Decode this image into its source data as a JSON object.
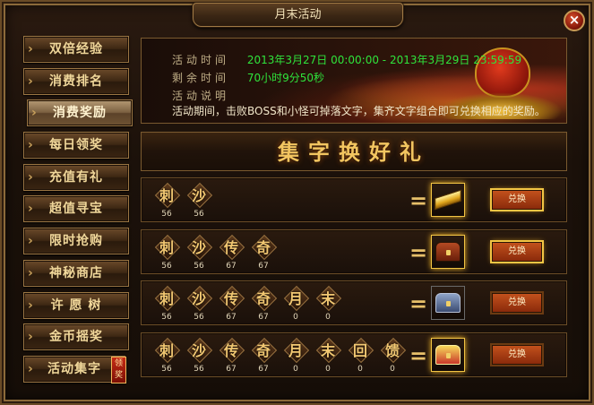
{
  "window": {
    "title": "月末活动",
    "close_label": "×"
  },
  "menu": {
    "items": [
      {
        "label": "双倍经验",
        "active": false
      },
      {
        "label": "消费排名",
        "active": false
      },
      {
        "label": "消费奖励",
        "active": true
      },
      {
        "label": "每日领奖",
        "active": false
      },
      {
        "label": "充值有礼",
        "active": false
      },
      {
        "label": "超值寻宝",
        "active": false
      },
      {
        "label": "限时抢购",
        "active": false
      },
      {
        "label": "神秘商店",
        "active": false
      },
      {
        "label": "许 愿 树",
        "active": false
      },
      {
        "label": "金币摇奖",
        "active": false
      },
      {
        "label": "活动集字",
        "active": false
      }
    ],
    "badge": "领奖"
  },
  "banner": {
    "time_label": "活动时间",
    "time_value": "2013年3月27日 00:00:00 - 2013年3月29日 23:59:59",
    "remaining_label": "剩余时间",
    "remaining_value": "70小时9分50秒",
    "desc_label": "活动说明",
    "desc_value": "活动期间，击败BOSS和小怪可掉落文字，集齐文字组合即可兑换相应的奖励。"
  },
  "section_title": "集字换好礼",
  "exchange_label": "兑换",
  "rows": [
    {
      "chars": [
        {
          "c": "刺",
          "n": "56"
        },
        {
          "c": "沙",
          "n": "56"
        }
      ],
      "reward": "gold-bar",
      "highlight": true
    },
    {
      "chars": [
        {
          "c": "刺",
          "n": "56"
        },
        {
          "c": "沙",
          "n": "56"
        },
        {
          "c": "传",
          "n": "67"
        },
        {
          "c": "奇",
          "n": "67"
        }
      ],
      "reward": "red-chest",
      "highlight": true
    },
    {
      "chars": [
        {
          "c": "刺",
          "n": "56"
        },
        {
          "c": "沙",
          "n": "56"
        },
        {
          "c": "传",
          "n": "67"
        },
        {
          "c": "奇",
          "n": "67"
        },
        {
          "c": "月",
          "n": "0"
        },
        {
          "c": "末",
          "n": "0"
        }
      ],
      "reward": "blue-chest",
      "highlight": false
    },
    {
      "chars": [
        {
          "c": "刺",
          "n": "56"
        },
        {
          "c": "沙",
          "n": "56"
        },
        {
          "c": "传",
          "n": "67"
        },
        {
          "c": "奇",
          "n": "67"
        },
        {
          "c": "月",
          "n": "0"
        },
        {
          "c": "末",
          "n": "0"
        },
        {
          "c": "回",
          "n": "0"
        },
        {
          "c": "馈",
          "n": "0"
        }
      ],
      "reward": "gold-chest",
      "highlight": false
    }
  ]
}
